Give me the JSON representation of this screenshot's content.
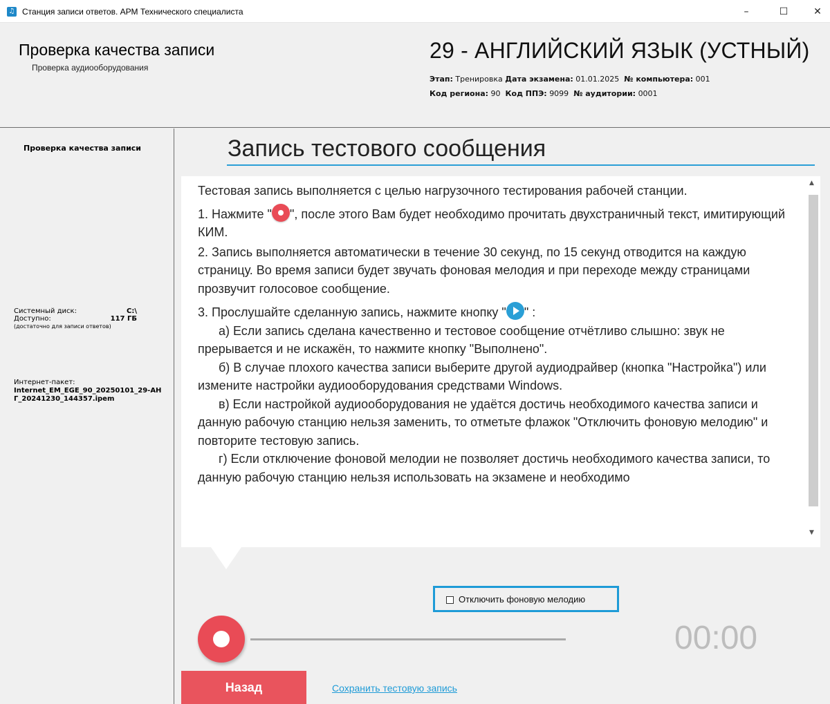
{
  "window": {
    "title": "Станция записи ответов. АРМ Технического специалиста",
    "minimize": "–",
    "maximize": "☐",
    "close": "✕"
  },
  "header": {
    "title": "Проверка качества записи",
    "subtitle": "Проверка аудиооборудования",
    "subject": "29 - АНГЛИЙСКИЙ ЯЗЫК (УСТНЫЙ)",
    "meta": {
      "stage_label": "Этап:",
      "stage_value": "Тренировка",
      "exam_date_label": "Дата экзамена:",
      "exam_date_value": "01.01.2025",
      "computer_label": "№ компьютера:",
      "computer_value": "001",
      "region_label": "Код региона:",
      "region_value": "90",
      "ppe_label": "Код ППЭ:",
      "ppe_value": "9099",
      "room_label": "№ аудитории:",
      "room_value": "0001"
    }
  },
  "sidebar": {
    "heading": "Проверка качества записи",
    "disk_label": "Системный диск:",
    "disk_value": "C:\\",
    "free_label": "Доступно:",
    "free_value": "117 ГБ",
    "free_note": "(достаточно для записи ответов)",
    "package_label": "Интернет-пакет:",
    "package_value": "Internet_EM_EGE_90_20250101_29-АНГ_20241230_144357.ipem"
  },
  "main": {
    "title": "Запись тестового сообщения",
    "instructions": {
      "intro": "Тестовая запись выполняется с целью нагрузочного тестирования рабочей станции.",
      "step1_pre": " 1. Нажмите \"",
      "step1_post": "\", после этого Вам будет необходимо прочитать двухстраничный текст, имитирующий КИМ.",
      "step2": " 2. Запись выполняется автоматически в течение 30 секунд, по 15 секунд отводится на каждую страницу. Во время записи будет звучать фоновая мелодия и при переходе между страницами прозвучит голосовое сообщение.",
      "step3_pre": " 3. Прослушайте сделанную запись, нажмите кнопку \"",
      "step3_post": "\" :",
      "item_a": "а) Если запись сделана качественно и тестовое сообщение отчётливо слышно: звук не прерывается и не искажён, то нажмите кнопку \"Выполнено\".",
      "item_b": "б) В случае плохого качества записи выберите другой аудиодрайвер (кнопка \"Настройка\") или измените настройки аудиооборудования средствами Windows.",
      "item_v": "в) Если настройкой аудиооборудования не удаётся достичь необходимого качества записи и данную рабочую станцию нельзя заменить, то отметьте флажок \"Отключить фоновую мелодию\" и повторите тестовую запись.",
      "item_g": "г) Если отключение фоновой мелодии не позволяет достичь необходимого качества записи, то данную рабочую станцию нельзя использовать на экзамене и необходимо"
    },
    "mute_checkbox_label": "Отключить фоновую мелодию",
    "mute_checked": false,
    "recording_progress": 0,
    "timer": "00:00",
    "back_button": "Назад",
    "save_link": "Сохранить тестовую запись"
  },
  "colors": {
    "accent": "#1e9bd7",
    "record": "#e94b56",
    "back_button": "#e9545d"
  }
}
